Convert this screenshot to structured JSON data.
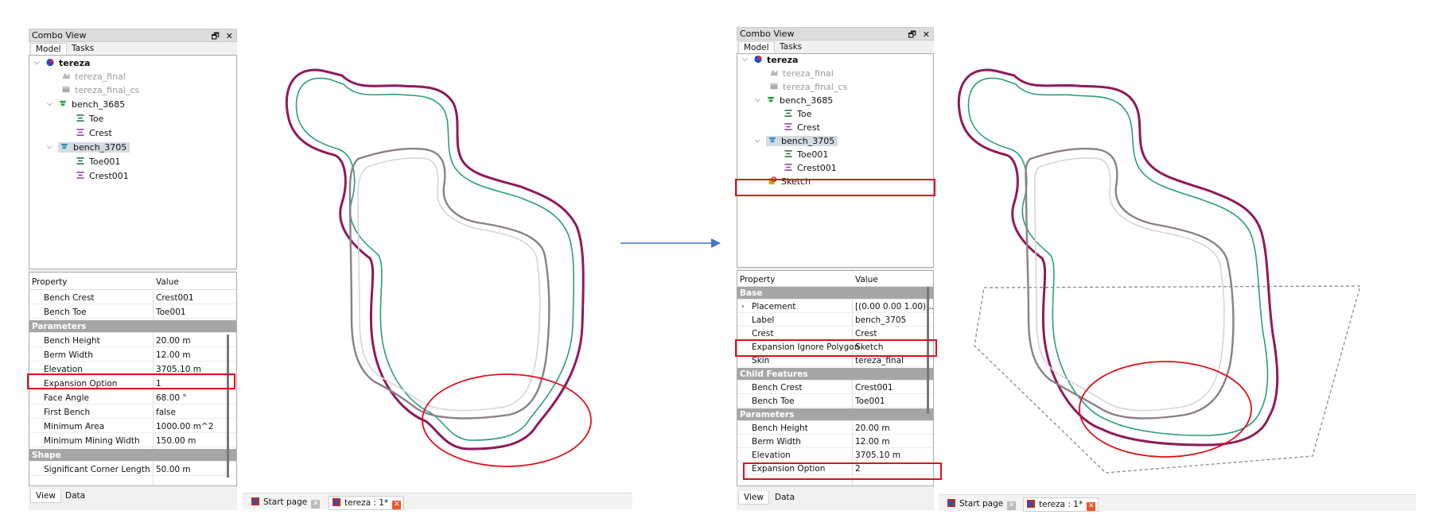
{
  "left": {
    "combo_title": "Combo View",
    "tabs": [
      "Model",
      "Tasks"
    ],
    "tree": [
      {
        "label": "tereza",
        "bold": true
      },
      {
        "label": "tereza_final",
        "grey": true
      },
      {
        "label": "tereza_final_cs",
        "grey": true
      },
      {
        "label": "bench_3685"
      },
      {
        "label": "Toe"
      },
      {
        "label": "Crest"
      },
      {
        "label": "bench_3705",
        "selected": true
      },
      {
        "label": "Toe001"
      },
      {
        "label": "Crest001"
      }
    ],
    "prop_header": {
      "property": "Property",
      "value": "Value"
    },
    "props": [
      {
        "name": "Bench Crest",
        "value": "Crest001"
      },
      {
        "name": "Bench Toe",
        "value": "Toe001"
      },
      {
        "group": "Parameters"
      },
      {
        "name": "Bench Height",
        "value": "20.00 m"
      },
      {
        "name": "Berm Width",
        "value": "12.00 m"
      },
      {
        "name": "Elevation",
        "value": "3705.10 m"
      },
      {
        "name": "Expansion Option",
        "value": "1"
      },
      {
        "name": "Face Angle",
        "value": "68.00 °"
      },
      {
        "name": "First Bench",
        "value": "false"
      },
      {
        "name": "Minimum Area",
        "value": "1000.00 m^2"
      },
      {
        "name": "Minimum Mining Width",
        "value": "150.00 m"
      },
      {
        "group": "Shape"
      },
      {
        "name": "Significant Corner Length",
        "value": "50.00 m"
      }
    ],
    "bottom_tabs": [
      "View",
      "Data"
    ],
    "doc_tabs": [
      {
        "label": "Start page"
      },
      {
        "label": "tereza : 1*",
        "active": true
      }
    ]
  },
  "right": {
    "combo_title": "Combo View",
    "tabs": [
      "Model",
      "Tasks"
    ],
    "tree": [
      {
        "label": "tereza",
        "bold": true
      },
      {
        "label": "tereza_final",
        "grey": true
      },
      {
        "label": "tereza_final_cs",
        "grey": true
      },
      {
        "label": "bench_3685"
      },
      {
        "label": "Toe"
      },
      {
        "label": "Crest"
      },
      {
        "label": "bench_3705",
        "selected": true
      },
      {
        "label": "Toe001"
      },
      {
        "label": "Crest001"
      },
      {
        "label": "Sketch"
      }
    ],
    "prop_header": {
      "property": "Property",
      "value": "Value"
    },
    "props": [
      {
        "group": "Base"
      },
      {
        "name": "Placement",
        "value": "[(0.00 0.00 1.00);..."
      },
      {
        "name": "Label",
        "value": "bench_3705"
      },
      {
        "name": "Crest",
        "value": "Crest"
      },
      {
        "name": "Expansion Ignore Polygon",
        "value": "Sketch"
      },
      {
        "name": "Skin",
        "value": "tereza_final"
      },
      {
        "group": "Child Features"
      },
      {
        "name": "Bench Crest",
        "value": "Crest001"
      },
      {
        "name": "Bench Toe",
        "value": "Toe001"
      },
      {
        "group": "Parameters"
      },
      {
        "name": "Bench Height",
        "value": "20.00 m"
      },
      {
        "name": "Berm Width",
        "value": "12.00 m"
      },
      {
        "name": "Elevation",
        "value": "3705.10 m"
      },
      {
        "name": "Expansion Option",
        "value": "2"
      }
    ],
    "bottom_tabs": [
      "View",
      "Data"
    ],
    "doc_tabs": [
      {
        "label": "Start page"
      },
      {
        "label": "tereza : 1*",
        "active": true
      }
    ]
  },
  "colors": {
    "crest_outer": "#8e1a5b",
    "toe_teal": "#2a9d7f",
    "inner_grey": "#8a8086",
    "inner_light": "#d8d4d8",
    "highlight_red": "#e0101a",
    "arrow_blue": "#4472c4"
  },
  "icons": [
    "pit-icon",
    "mesh-icon",
    "solid-icon",
    "bench-icon",
    "toe-line-icon",
    "crest-line-icon",
    "sketch-icon",
    "freecad-icon",
    "close-icon",
    "restore-icon"
  ]
}
